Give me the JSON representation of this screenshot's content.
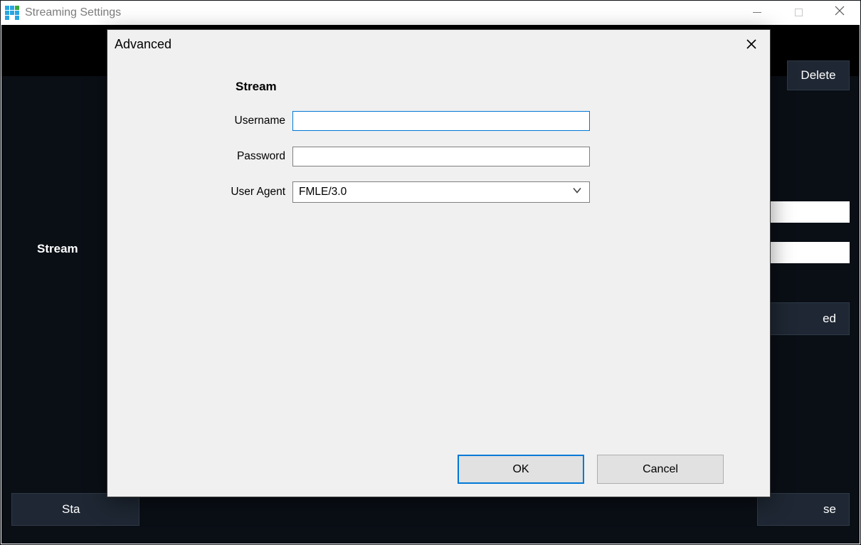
{
  "parent_window": {
    "title": "Streaming Settings",
    "stream_label": "Stream",
    "buttons": {
      "delete": "Delete",
      "advanced_fragment": "ed",
      "start_fragment": "Sta",
      "close_fragment": "se"
    }
  },
  "dialog": {
    "title": "Advanced",
    "section_heading": "Stream",
    "fields": {
      "username_label": "Username",
      "username_value": "",
      "password_label": "Password",
      "password_value": "",
      "user_agent_label": "User Agent",
      "user_agent_value": "FMLE/3.0"
    },
    "buttons": {
      "ok": "OK",
      "cancel": "Cancel"
    }
  }
}
